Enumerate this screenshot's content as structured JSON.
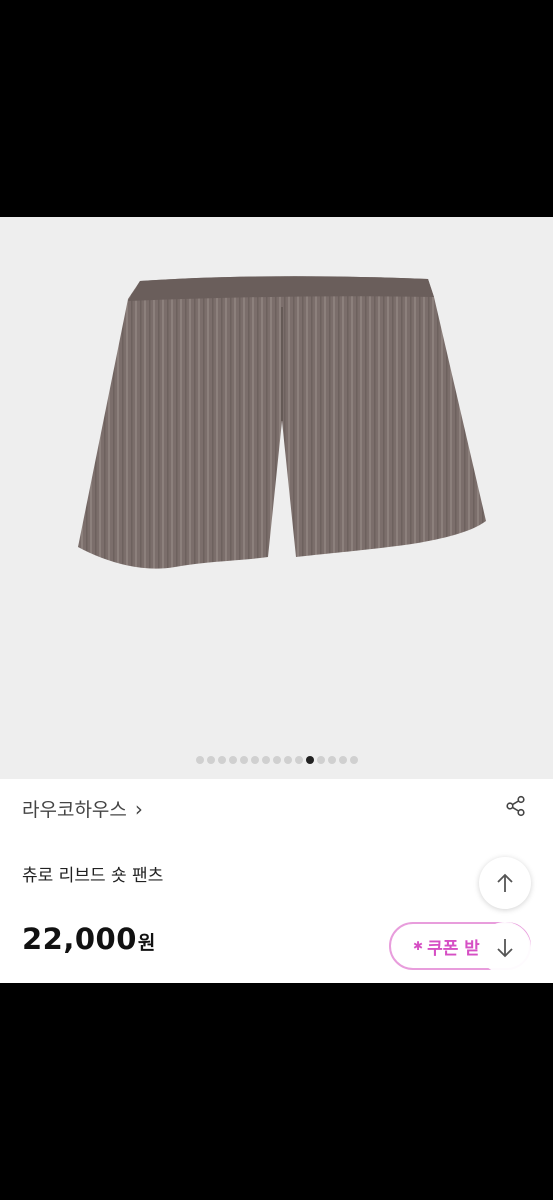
{
  "product": {
    "brand": "라우코하우스",
    "title": "츄로 리브드 숏 팬츠",
    "price_amount": "22,000",
    "price_unit": "원"
  },
  "gallery": {
    "total": 15,
    "active_index": 10
  },
  "actions": {
    "coupon_label": "쿠폰 받"
  },
  "icons": {
    "brand_chevron": "chevron-right-icon",
    "share": "share-icon",
    "scroll_up": "arrow-up-icon",
    "scroll_down": "arrow-down-icon",
    "coupon": "star-icon"
  },
  "colors": {
    "coupon_accent": "#d64fc4",
    "image_background": "#eeeeee",
    "shorts_fabric": "#7b6e6b"
  }
}
